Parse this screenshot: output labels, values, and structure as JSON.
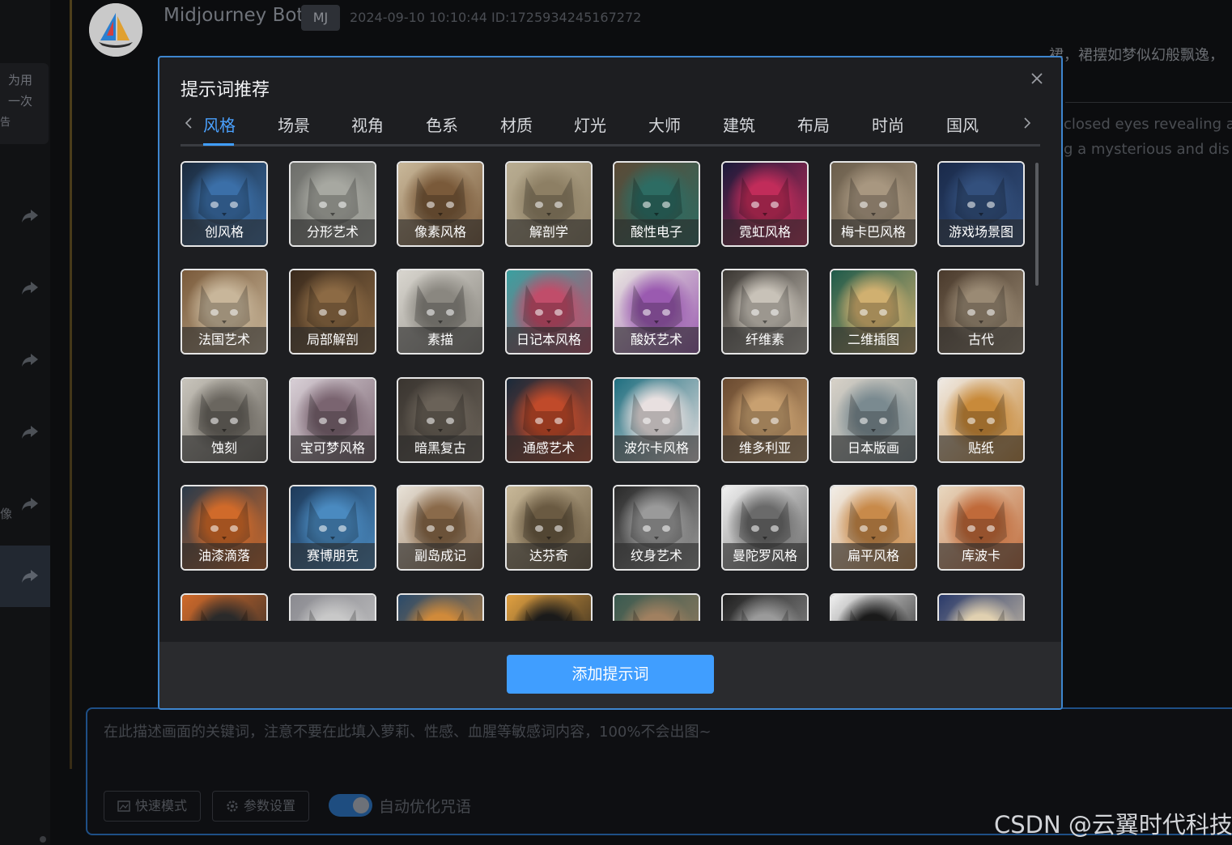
{
  "sidebar": {
    "card_lines": [
      "为用",
      "一次",
      "告"
    ],
    "side_label": "像"
  },
  "message": {
    "bot_name": "Midjourney Bot",
    "badge": "MJ",
    "meta": "2024-09-10 10:10:44 ID:1725934245167272",
    "line1": "裙，裙摆如梦似幻般飘逸，",
    "line2": "closed eyes revealing a",
    "line3": "g a mysterious and dis"
  },
  "composer": {
    "placeholder": "在此描述画面的关键词，注意不要在此填入萝莉、性感、血腥等敏感词内容，100%不会出图~",
    "fast_mode": "快速模式",
    "params": "参数设置",
    "auto_optimize": "自动优化咒语",
    "auto_optimize_on": true
  },
  "watermark": "CSDN @云翼时代科技",
  "modal": {
    "title": "提示词推荐",
    "tabs": [
      "风格",
      "场景",
      "视角",
      "色系",
      "材质",
      "灯光",
      "大师",
      "建筑",
      "布局",
      "时尚",
      "国风"
    ],
    "active_tab": "风格",
    "cards": [
      {
        "label": "创风格",
        "c1": "#1b2a3c",
        "c2": "#3b6fa8"
      },
      {
        "label": "分形艺术",
        "c1": "#6d6e6a",
        "c2": "#a7a8a1"
      },
      {
        "label": "像素风格",
        "c1": "#c9b89a",
        "c2": "#7a5a3a"
      },
      {
        "label": "解剖学",
        "c1": "#b9ad92",
        "c2": "#8d7f64"
      },
      {
        "label": "酸性电子",
        "c1": "#5b4a36",
        "c2": "#2d6c63"
      },
      {
        "label": "霓虹风格",
        "c1": "#1a1a3a",
        "c2": "#c12c5a"
      },
      {
        "label": "梅卡巴风格",
        "c1": "#6b5e4c",
        "c2": "#a89780"
      },
      {
        "label": "游戏场景图",
        "c1": "#1a2a4a",
        "c2": "#33507d"
      },
      {
        "label": "法国艺术",
        "c1": "#7a5a3a",
        "c2": "#c8b69a"
      },
      {
        "label": "局部解剖",
        "c1": "#3a2a1c",
        "c2": "#8c6a44"
      },
      {
        "label": "素描",
        "c1": "#d9d6cf",
        "c2": "#8a8780"
      },
      {
        "label": "日记本风格",
        "c1": "#3aa0a0",
        "c2": "#c04d6a"
      },
      {
        "label": "酸妖艺术",
        "c1": "#e8e4e0",
        "c2": "#9a5ab0"
      },
      {
        "label": "纤维素",
        "c1": "#3a3632",
        "c2": "#c8c2b8"
      },
      {
        "label": "二维插图",
        "c1": "#1e5a4a",
        "c2": "#d0b070"
      },
      {
        "label": "古代",
        "c1": "#4a3a2c",
        "c2": "#9a8a74"
      },
      {
        "label": "蚀刻",
        "c1": "#c9c5bc",
        "c2": "#6a665f"
      },
      {
        "label": "宝可梦风格",
        "c1": "#d8cfd6",
        "c2": "#7a6470"
      },
      {
        "label": "暗黑复古",
        "c1": "#3a3530",
        "c2": "#6a6258"
      },
      {
        "label": "通感艺术",
        "c1": "#1a2a3a",
        "c2": "#c04a2a"
      },
      {
        "label": "波尔卡风格",
        "c1": "#1f6f80",
        "c2": "#e8e0e0"
      },
      {
        "label": "维多利亚",
        "c1": "#6a4a30",
        "c2": "#c8a070"
      },
      {
        "label": "日本版画",
        "c1": "#d8d2c8",
        "c2": "#7a8a90"
      },
      {
        "label": "贴纸",
        "c1": "#efeae4",
        "c2": "#c88a3a"
      },
      {
        "label": "油漆滴落",
        "c1": "#2a3a4a",
        "c2": "#d06a2a"
      },
      {
        "label": "赛博朋克",
        "c1": "#1e3a5a",
        "c2": "#4a8ac0"
      },
      {
        "label": "副岛成记",
        "c1": "#e8e2d8",
        "c2": "#8a6a4a"
      },
      {
        "label": "达芬奇",
        "c1": "#c8b898",
        "c2": "#6a5a42"
      },
      {
        "label": "纹身艺术",
        "c1": "#2a2a2a",
        "c2": "#9a9a9a"
      },
      {
        "label": "曼陀罗风格",
        "c1": "#f0f0f0",
        "c2": "#6a6a6a"
      },
      {
        "label": "扁平风格",
        "c1": "#f2eee8",
        "c2": "#c88a4a"
      },
      {
        "label": "库波卡",
        "c1": "#e8d8c0",
        "c2": "#c06a3a"
      },
      {
        "label": "",
        "c1": "#d06a2a",
        "c2": "#2a2a2a"
      },
      {
        "label": "",
        "c1": "#8a8a90",
        "c2": "#c8c8c8"
      },
      {
        "label": "",
        "c1": "#2a4a6a",
        "c2": "#d08a3a"
      },
      {
        "label": "",
        "c1": "#e0a040",
        "c2": "#1a1a1a"
      },
      {
        "label": "",
        "c1": "#3a5a50",
        "c2": "#a08060"
      },
      {
        "label": "",
        "c1": "#202020",
        "c2": "#9a9a9a"
      },
      {
        "label": "",
        "c1": "#f0f0f0",
        "c2": "#1a1a1a"
      },
      {
        "label": "",
        "c1": "#2a3a6a",
        "c2": "#e0d0b0"
      }
    ],
    "add_button": "添加提示词"
  },
  "colors": {
    "accent": "#409eff",
    "modal_border": "#3e86cf"
  }
}
